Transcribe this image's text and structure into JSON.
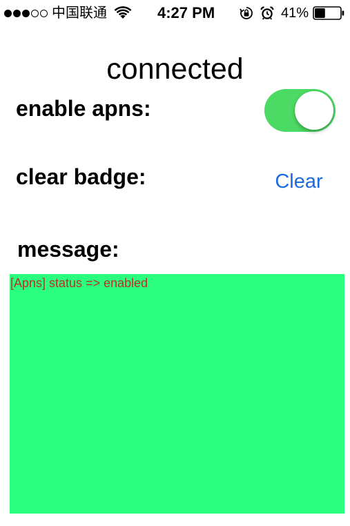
{
  "status_bar": {
    "signal_bars_filled": 3,
    "signal_bars_total": 5,
    "carrier": "中国联通",
    "wifi_icon": "wifi-icon",
    "time": "4:27 PM",
    "orientation_lock_icon": "orientation-lock-icon",
    "alarm_icon": "alarm-icon",
    "battery_percent": "41%",
    "battery_level": 0.41
  },
  "header": {
    "title": "connected"
  },
  "settings": {
    "apns_label": "enable apns:",
    "apns_enabled": true,
    "badge_label": "clear badge:",
    "clear_button_label": "Clear",
    "message_label": "message:"
  },
  "message_box": {
    "text": "[Apns] status => enabled"
  },
  "colors": {
    "toggle_on": "#4cd964",
    "link_blue": "#1a6ae0",
    "message_background": "#2aff80",
    "message_text": "#b83226"
  }
}
